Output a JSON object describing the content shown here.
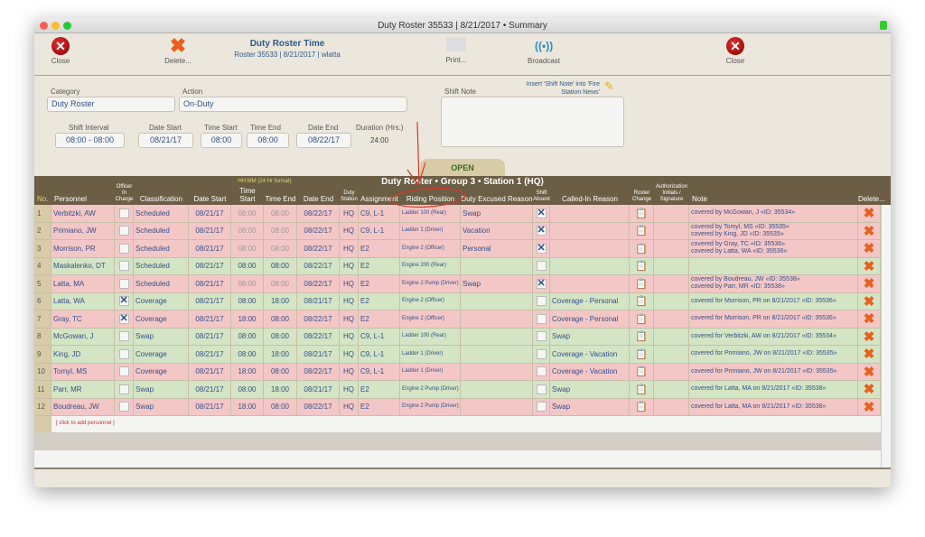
{
  "window": {
    "title": "Duty Roster 35533 | 8/21/2017 • Summary"
  },
  "toolbar": {
    "close_left": "Close",
    "delete": "Delete...",
    "heading": "Duty Roster Time",
    "subheading": "Roster 35533 | 8/21/2017 | wlatta",
    "print": "Print...",
    "broadcast": "Broadcast",
    "close_right": "Close"
  },
  "form": {
    "category_label": "Category",
    "category_value": "Duty Roster",
    "action_label": "Action",
    "action_value": "On-Duty",
    "shift_interval_label": "Shift Interval",
    "shift_interval_value": "08:00 - 08:00",
    "date_start_label": "Date Start",
    "date_start_value": "08/21/17",
    "time_start_label": "Time Start",
    "time_start_value": "08:00",
    "time_end_label": "Time End",
    "time_end_value": "08:00",
    "date_end_label": "Date End",
    "date_end_value": "08/22/17",
    "duration_label": "Duration (Hrs.)",
    "duration_value": "24:00",
    "shift_note_label": "Shift Note",
    "shift_note_value": "",
    "insert_note_link": "Insert 'Shift Note' into 'Fire Station News'",
    "status_tab": "OPEN"
  },
  "table": {
    "group_title": "Duty Roster • Group 3 • Station 1 (HQ)",
    "time_format_hint": "HH:MM (24 Hr format)",
    "headers": {
      "no": "No.",
      "personnel": "Personnel",
      "officer": "Officer In Charge",
      "classification": "Classification",
      "date_start": "Date Start",
      "time_start": "Time Start",
      "time_end": "Time End",
      "date_end": "Date End",
      "station": "Duty Station",
      "assignment": "Assignment",
      "riding": "Riding Position",
      "excused": "Duty Excused Reason",
      "absent": "Shift Absent",
      "called": "Called-In Reason",
      "roster_change": "Roster Change",
      "auth": "Authorization Initials / Signature",
      "note": "Note",
      "delete": "Delete..."
    },
    "rows": [
      {
        "no": "1",
        "name": "Verbitzki, AW",
        "oic": false,
        "cls": "Scheduled",
        "ds": "08/21/17",
        "ts": "08:00",
        "te": "08:00",
        "de": "08/22/17",
        "st": "HQ",
        "asg": "C9, L-1",
        "ride": "Ladder 100 (Rear)",
        "exc": "Swap",
        "abs": true,
        "called": "",
        "note": [
          "covered by McGowan, J «ID: 35534»"
        ],
        "status": "absent",
        "dim": true
      },
      {
        "no": "2",
        "name": "Primiano, JW",
        "oic": false,
        "cls": "Scheduled",
        "ds": "08/21/17",
        "ts": "08:00",
        "te": "08:00",
        "de": "08/22/17",
        "st": "HQ",
        "asg": "C9, L-1",
        "ride": "Ladder 1 (Driver)",
        "exc": "Vacation",
        "abs": true,
        "called": "",
        "note": [
          "covered by Tomyl, MS «ID: 35535»",
          "covered by King, JD «ID: 35535»"
        ],
        "status": "absent",
        "dim": true
      },
      {
        "no": "3",
        "name": "Morrison, PR",
        "oic": false,
        "cls": "Scheduled",
        "ds": "08/21/17",
        "ts": "08:00",
        "te": "08:00",
        "de": "08/22/17",
        "st": "HQ",
        "asg": "E2",
        "ride": "Engine 2 (Officer)",
        "exc": "Personal",
        "abs": true,
        "called": "",
        "note": [
          "covered by Gray, TC «ID: 35536»",
          "covered by Latta, WA «ID: 35536»"
        ],
        "status": "absent",
        "dim": true
      },
      {
        "no": "4",
        "name": "Maskalenko, DT",
        "oic": false,
        "cls": "Scheduled",
        "ds": "08/21/17",
        "ts": "08:00",
        "te": "08:00",
        "de": "08/22/17",
        "st": "HQ",
        "asg": "E2",
        "ride": "Engine 200 (Rear)",
        "exc": "",
        "abs": false,
        "called": "",
        "note": [],
        "status": "present",
        "dim": false
      },
      {
        "no": "5",
        "name": "Latta, MA",
        "oic": false,
        "cls": "Scheduled",
        "ds": "08/21/17",
        "ts": "08:00",
        "te": "08:00",
        "de": "08/22/17",
        "st": "HQ",
        "asg": "E2",
        "ride": "Engine 2 Pump (Driver)",
        "exc": "Swap",
        "abs": true,
        "called": "",
        "note": [
          "covered by Boudreau, JW «ID: 35538»",
          "covered by Parr, MR «ID: 35538»"
        ],
        "status": "absent",
        "dim": true
      },
      {
        "no": "6",
        "name": "Latta, WA",
        "oic": true,
        "cls": "Coverage",
        "ds": "08/21/17",
        "ts": "08:00",
        "te": "18:00",
        "de": "08/21/17",
        "st": "HQ",
        "asg": "E2",
        "ride": "Engine 2 (Officer)",
        "exc": "",
        "abs": false,
        "called": "Coverage - Personal",
        "note": [
          "covered for Morrison, PR on 8/21/2017 «ID: 35536»"
        ],
        "status": "present",
        "dim": false
      },
      {
        "no": "7",
        "name": "Gray, TC",
        "oic": true,
        "cls": "Coverage",
        "ds": "08/21/17",
        "ts": "18:00",
        "te": "08:00",
        "de": "08/22/17",
        "st": "HQ",
        "asg": "E2",
        "ride": "Engine 2 (Officer)",
        "exc": "",
        "abs": false,
        "called": "Coverage - Personal",
        "note": [
          "covered for Morrison, PR on 8/21/2017 «ID: 35536»"
        ],
        "status": "absent",
        "dim": false
      },
      {
        "no": "8",
        "name": "McGowan, J",
        "oic": false,
        "cls": "Swap",
        "ds": "08/21/17",
        "ts": "08:00",
        "te": "08:00",
        "de": "08/22/17",
        "st": "HQ",
        "asg": "C9, L-1",
        "ride": "Ladder 100 (Rear)",
        "exc": "",
        "abs": false,
        "called": "Swap",
        "note": [
          "covered for Verbitzki, AW on 8/21/2017 «ID: 35534»"
        ],
        "status": "present",
        "dim": false
      },
      {
        "no": "9",
        "name": "King, JD",
        "oic": false,
        "cls": "Coverage",
        "ds": "08/21/17",
        "ts": "08:00",
        "te": "18:00",
        "de": "08/21/17",
        "st": "HQ",
        "asg": "C9, L-1",
        "ride": "Ladder 1 (Driver)",
        "exc": "",
        "abs": false,
        "called": "Coverage - Vacation",
        "note": [
          "covered for Primiano, JW on 8/21/2017 «ID: 35535»"
        ],
        "status": "present",
        "dim": false
      },
      {
        "no": "10",
        "name": "Tomyl, MS",
        "oic": false,
        "cls": "Coverage",
        "ds": "08/21/17",
        "ts": "18:00",
        "te": "08:00",
        "de": "08/22/17",
        "st": "HQ",
        "asg": "C9, L-1",
        "ride": "Ladder 1 (Driver)",
        "exc": "",
        "abs": false,
        "called": "Coverage - Vacation",
        "note": [
          "covered for Primiano, JW on 8/21/2017 «ID: 35535»"
        ],
        "status": "absent",
        "dim": false
      },
      {
        "no": "11",
        "name": "Parr, MR",
        "oic": false,
        "cls": "Swap",
        "ds": "08/21/17",
        "ts": "08:00",
        "te": "18:00",
        "de": "08/21/17",
        "st": "HQ",
        "asg": "E2",
        "ride": "Engine 2 Pump (Driver)",
        "exc": "",
        "abs": false,
        "called": "Swap",
        "note": [
          "covered for Latta, MA on 8/21/2017 «ID: 35538»"
        ],
        "status": "present",
        "dim": false
      },
      {
        "no": "12",
        "name": "Boudreau, JW",
        "oic": false,
        "cls": "Swap",
        "ds": "08/21/17",
        "ts": "18:00",
        "te": "08:00",
        "de": "08/22/17",
        "st": "HQ",
        "asg": "E2",
        "ride": "Engine 2 Pump (Driver)",
        "exc": "",
        "abs": false,
        "called": "Swap",
        "note": [
          "covered for Latta, MA on 8/21/2017 «ID: 35538»"
        ],
        "status": "absent",
        "dim": false
      }
    ],
    "add_personnel": "[ click to add personnel ]"
  },
  "colors": {
    "absent_row": "#f4c7c7",
    "present_row": "#d3e5c4",
    "header": "#6b5e45",
    "accent_text": "#34508a",
    "annotation": "#d9362b"
  }
}
